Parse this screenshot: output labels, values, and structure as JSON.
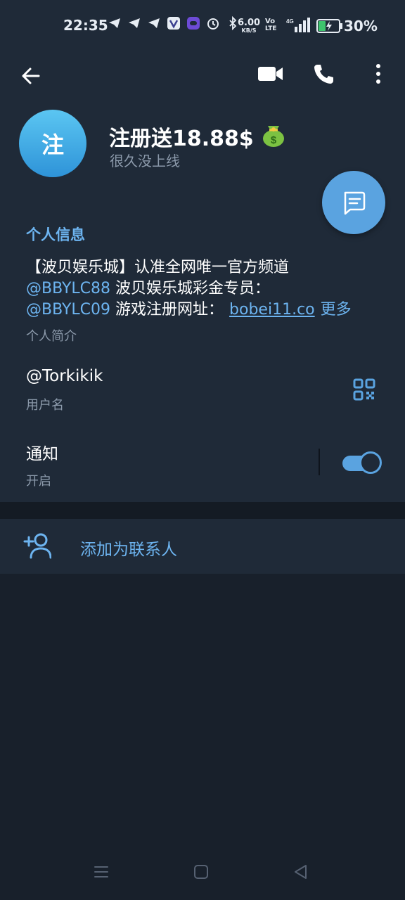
{
  "status_bar": {
    "time": "22:35",
    "net_speed_value": "6.00",
    "net_speed_unit": "KB/S",
    "volte_top": "Vo",
    "volte_bottom": "LTE",
    "signal_label": "4G",
    "battery_percent": "30%",
    "icons": [
      "telegram-icon",
      "telegram-icon",
      "telegram-icon",
      "vpn-icon",
      "app-icon",
      "alarm-icon",
      "bluetooth-icon"
    ]
  },
  "header": {
    "avatar_letter": "注",
    "name": "注册送18.88$",
    "name_emoji": "💰",
    "status": "很久没上线"
  },
  "info": {
    "section_title": "个人信息",
    "bio_line1": "【波贝娱乐城】认准全网唯一官方频道",
    "bio_link1": "@BBYLC88",
    "bio_line2_text": " 波贝娱乐城彩金专员：",
    "bio_link2": "@BBYLC09",
    "bio_line3_text": " 游戏注册网址：",
    "bio_url": "bobei11.co",
    "bio_more": "更多",
    "bio_caption": "个人简介",
    "username": "@Torkikik",
    "username_caption": "用户名",
    "notify_label": "通知",
    "notify_caption": "开启"
  },
  "actions": {
    "add_contact": "添加为联系人"
  },
  "colors": {
    "accent": "#5aa3e0",
    "link": "#6db4f0",
    "panel": "#1f2a38",
    "background": "#18202b"
  }
}
